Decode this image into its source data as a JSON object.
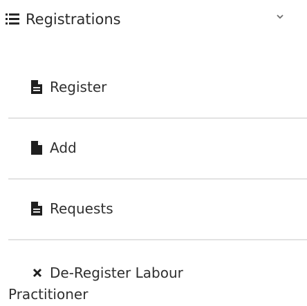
{
  "menu": {
    "header": {
      "label": "Registrations",
      "icon": "list-icon",
      "chevron": "chevron-down-icon"
    },
    "items": [
      {
        "label": "Register",
        "icon": "file-text-icon"
      },
      {
        "label": "Add",
        "icon": "file-icon"
      },
      {
        "label": "Requests",
        "icon": "file-text-icon"
      }
    ],
    "last_item": {
      "label_line1": "De-Register Labour",
      "label_line2": "Practitioner",
      "icon": "close-icon"
    }
  },
  "colors": {
    "text": "#2f2f2f",
    "divider": "#e2e2e2",
    "background": "#ffffff"
  }
}
